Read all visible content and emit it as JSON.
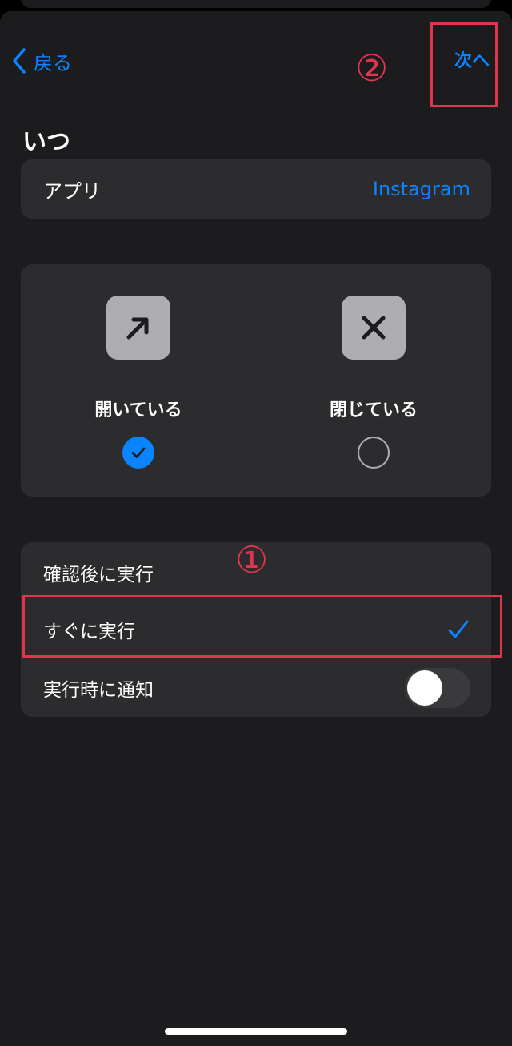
{
  "nav": {
    "back_label": "戻る",
    "next_label": "次へ"
  },
  "annotations": {
    "step1": "①",
    "step2": "②",
    "color": "#e0354f"
  },
  "page_title": "いつ",
  "app_row": {
    "label": "アプリ",
    "value": "Instagram"
  },
  "states": [
    {
      "label": "開いている",
      "icon": "arrow-up-right-icon",
      "selected": true
    },
    {
      "label": "閉じている",
      "icon": "x-mark-icon",
      "selected": false
    }
  ],
  "options": [
    {
      "label": "確認後に実行",
      "selected": false
    },
    {
      "label": "すぐに実行",
      "selected": true
    },
    {
      "label": "実行時に通知",
      "toggle": false
    }
  ],
  "colors": {
    "accent": "#0a84ff",
    "background": "#1c1c1e",
    "card": "#2c2c2e"
  }
}
